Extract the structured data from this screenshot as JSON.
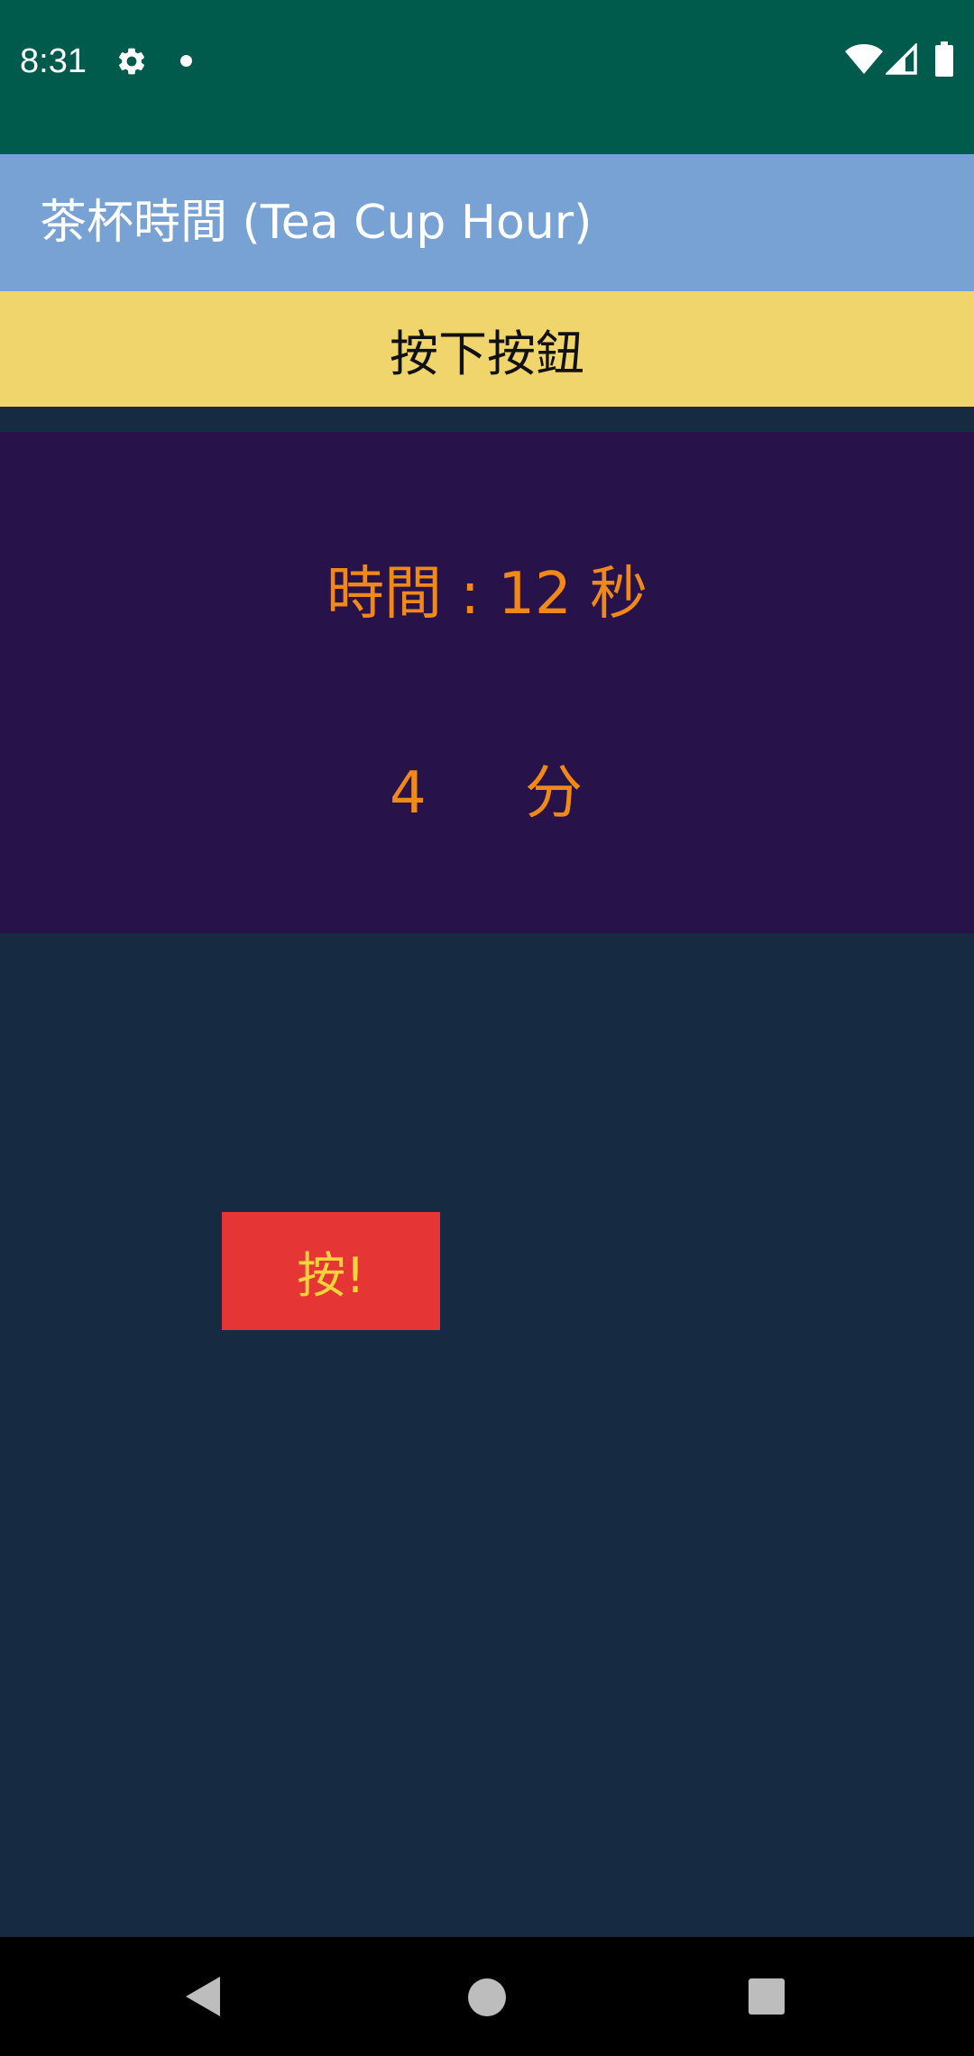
{
  "status_bar": {
    "time": "8:31",
    "icons": [
      "gear-icon",
      "notification-dot-icon",
      "wifi-icon",
      "cell-signal-icon",
      "battery-icon"
    ]
  },
  "app_bar": {
    "title": "茶杯時間 (Tea Cup Hour)"
  },
  "prompt_banner": {
    "text": "按下按鈕"
  },
  "timer": {
    "seconds_label": "時間 :",
    "seconds_value": "12",
    "seconds_unit": "秒",
    "minutes_value": "4",
    "minutes_unit": "分"
  },
  "press_button": {
    "label": "按!"
  },
  "nav_bar": {
    "icons": [
      "back-icon",
      "home-icon",
      "recents-icon"
    ]
  },
  "colors": {
    "status_bar": "#005b4c",
    "app_bar": "#79a2d4",
    "banner": "#f0d46c",
    "panel": "#27124a",
    "timer_text": "#f08918",
    "background": "#162a42",
    "button": "#e53535",
    "button_text": "#f5d33a"
  }
}
